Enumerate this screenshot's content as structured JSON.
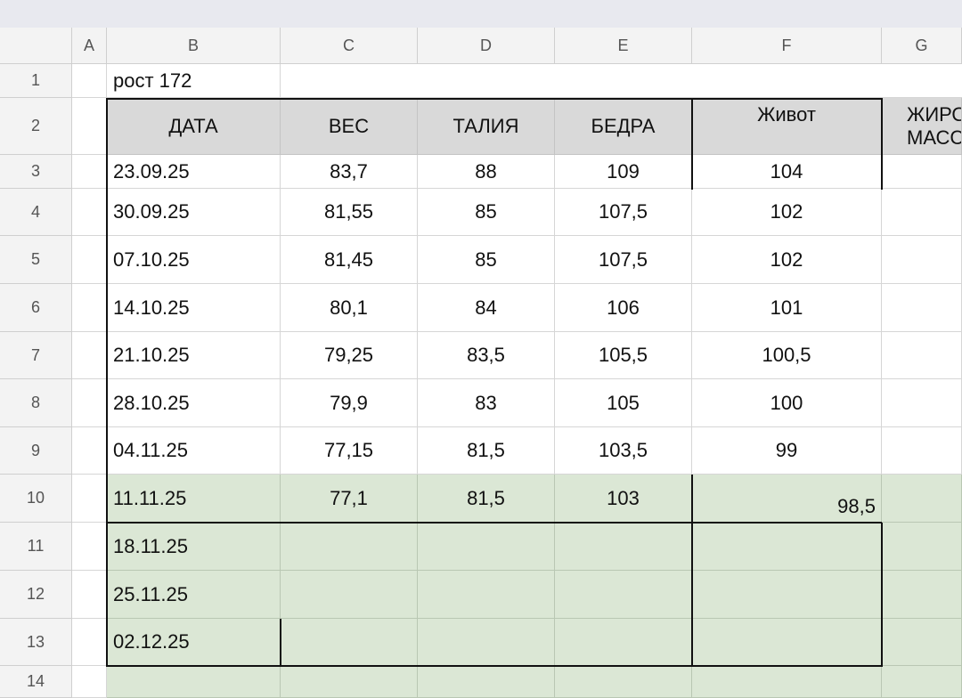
{
  "column_headers": [
    "A",
    "B",
    "C",
    "D",
    "E",
    "F",
    "G"
  ],
  "row_headers": [
    "1",
    "2",
    "3",
    "4",
    "5",
    "6",
    "7",
    "8",
    "9",
    "10",
    "11",
    "12",
    "13",
    "14"
  ],
  "b1_text": "рост 172",
  "table_headers": [
    "ДАТА",
    "ВЕС",
    "ТАЛИЯ",
    "БЕДРА",
    "Живот",
    "ЖИРОВАЯ МАССА"
  ],
  "rows": [
    {
      "date": "23.09.25",
      "weight": "83,7",
      "waist": "88",
      "hips": "109",
      "belly": "104"
    },
    {
      "date": "30.09.25",
      "weight": "81,55",
      "waist": "85",
      "hips": "107,5",
      "belly": "102"
    },
    {
      "date": "07.10.25",
      "weight": "81,45",
      "waist": "85",
      "hips": "107,5",
      "belly": "102"
    },
    {
      "date": "14.10.25",
      "weight": "80,1",
      "waist": "84",
      "hips": "106",
      "belly": "101"
    },
    {
      "date": "21.10.25",
      "weight": "79,25",
      "waist": "83,5",
      "hips": "105,5",
      "belly": "100,5"
    },
    {
      "date": "28.10.25",
      "weight": "79,9",
      "waist": "83",
      "hips": "105",
      "belly": "100"
    },
    {
      "date": "04.11.25",
      "weight": "77,15",
      "waist": "81,5",
      "hips": "103,5",
      "belly": "99"
    },
    {
      "date": "11.11.25",
      "weight": "77,1",
      "waist": "81,5",
      "hips": "103",
      "belly": "98,5"
    },
    {
      "date": "18.11.25",
      "weight": "",
      "waist": "",
      "hips": "",
      "belly": ""
    },
    {
      "date": "25.11.25",
      "weight": "",
      "waist": "",
      "hips": "",
      "belly": ""
    },
    {
      "date": "02.12.25",
      "weight": "",
      "waist": "",
      "hips": "",
      "belly": ""
    },
    {
      "date": "",
      "weight": "",
      "waist": "",
      "hips": "",
      "belly": ""
    }
  ],
  "colors": {
    "header_fill": "#d9d9d9",
    "highlight_fill": "#dbe7d5",
    "border": "#111111"
  }
}
